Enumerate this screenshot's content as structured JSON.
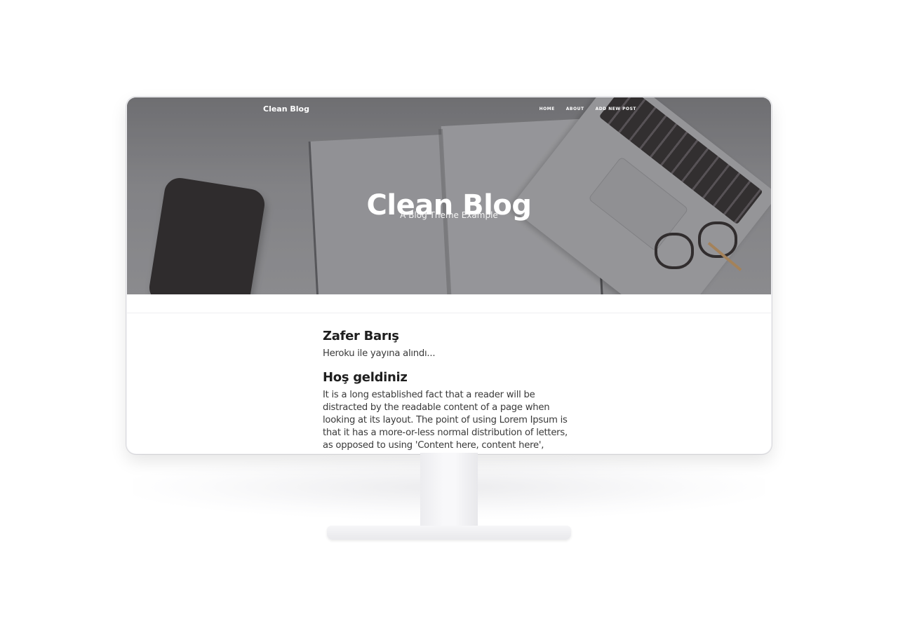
{
  "navbar": {
    "brand": "Clean Blog",
    "links": [
      "HOME",
      "ABOUT",
      "ADD NEW POST"
    ]
  },
  "hero": {
    "title": "Clean Blog",
    "subtitle": "A Blog Theme Example"
  },
  "posts": [
    {
      "title": "Zafer Barış",
      "body": "Heroku ile yayına alındı..."
    },
    {
      "title": "Hoş geldiniz",
      "body": "It is a long established fact that a reader will be distracted by the readable content of a page when looking at its layout. The point of using Lorem Ipsum is that it has a more-or-less normal distribution of letters, as opposed to using 'Content here, content here', making it look like"
    }
  ],
  "colors": {
    "hero_overlay": "#8e8e92",
    "text_dark": "#1f1f1f",
    "text_body": "#3a3a3a"
  }
}
